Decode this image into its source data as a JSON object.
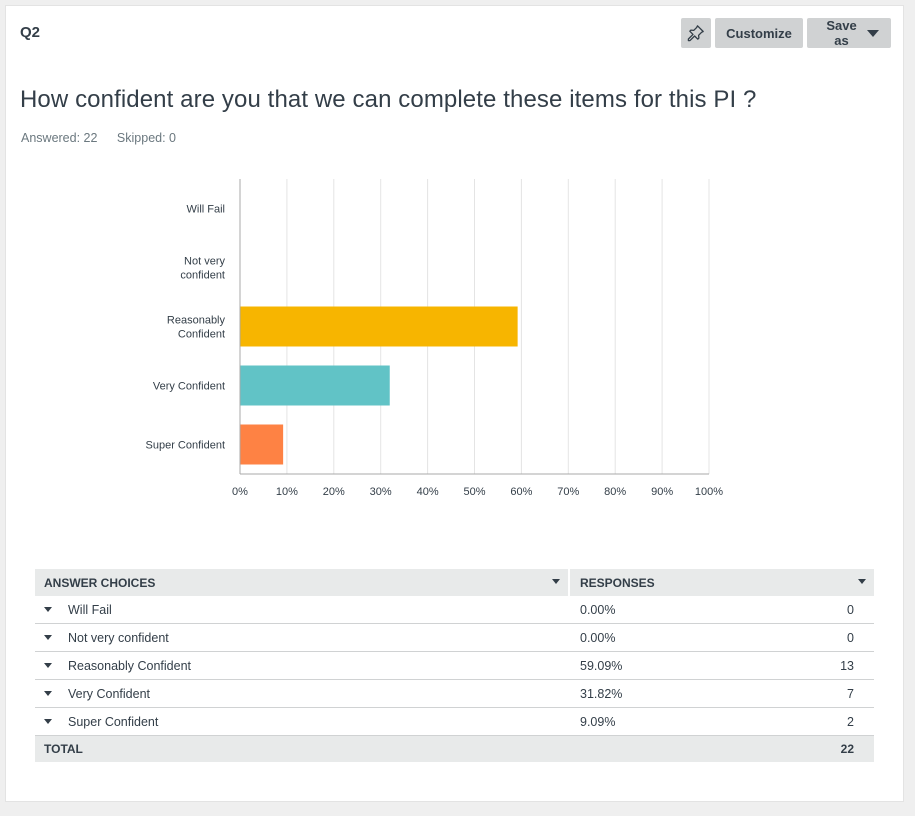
{
  "question": {
    "number": "Q2",
    "title": "How confident are you that we can complete these items for this PI ?",
    "answered": "Answered: 22",
    "skipped": "Skipped: 0"
  },
  "toolbar": {
    "pin_icon": "pin-icon",
    "customize_label": "Customize",
    "save_as_label": "Save as"
  },
  "colors": {
    "reasonably": "#f7b500",
    "very": "#61c3c6",
    "super": "#fe8244",
    "grid": "#e4e4e4",
    "axis": "#a9a9a9"
  },
  "chart_data": {
    "type": "bar",
    "orientation": "horizontal",
    "categories": [
      [
        "Will Fail"
      ],
      [
        "Not very",
        "confident"
      ],
      [
        "Reasonably",
        "Confident"
      ],
      [
        "Very Confident"
      ],
      [
        "Super Confident"
      ]
    ],
    "values": [
      0,
      0,
      59.09,
      31.82,
      9.09
    ],
    "bar_colors": [
      "#f7b500",
      "#f7b500",
      "#f7b500",
      "#61c3c6",
      "#fe8244"
    ],
    "xlim": [
      0,
      100
    ],
    "xticks": [
      "0%",
      "10%",
      "20%",
      "30%",
      "40%",
      "50%",
      "60%",
      "70%",
      "80%",
      "90%",
      "100%"
    ],
    "grid": true
  },
  "table": {
    "headers": [
      "ANSWER CHOICES",
      "RESPONSES"
    ],
    "rows": [
      {
        "choice": "Will Fail",
        "pct": "0.00%",
        "count": "0"
      },
      {
        "choice": "Not very confident",
        "pct": "0.00%",
        "count": "0"
      },
      {
        "choice": "Reasonably Confident",
        "pct": "59.09%",
        "count": "13"
      },
      {
        "choice": "Very Confident",
        "pct": "31.82%",
        "count": "7"
      },
      {
        "choice": "Super Confident",
        "pct": "9.09%",
        "count": "2"
      }
    ],
    "total_label": "TOTAL",
    "total_count": "22"
  }
}
